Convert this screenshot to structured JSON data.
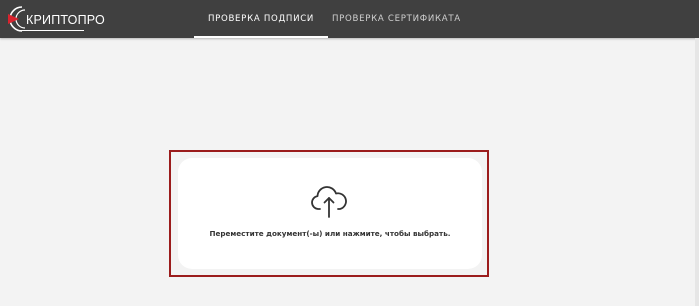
{
  "header": {
    "logo_text": "КРИПТОПРО",
    "tabs": [
      {
        "label": "ПРОВЕРКА ПОДПИСИ",
        "active": true
      },
      {
        "label": "ПРОВЕРКА СЕРТИФИКАТА",
        "active": false
      }
    ]
  },
  "dropzone": {
    "icon": "cloud-upload-icon",
    "text": "Переместите документ(-ы) или нажмите, чтобы выбрать."
  },
  "colors": {
    "header_bg": "#404040",
    "page_bg": "#f3f3f3",
    "logo_accent": "#d9232e",
    "highlight_border": "#9b1c1c"
  }
}
